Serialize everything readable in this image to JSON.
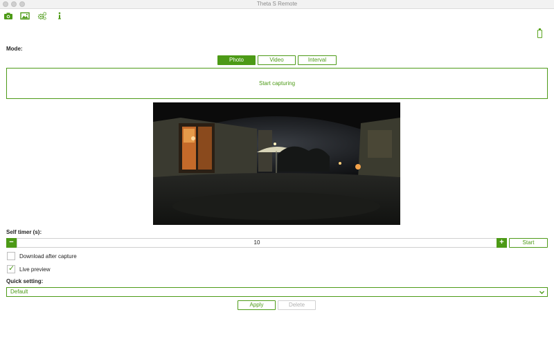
{
  "window": {
    "title": "Theta S Remote"
  },
  "toolbar": {
    "icons": [
      "camera-icon",
      "gallery-icon",
      "settings-gears-icon",
      "info-icon"
    ]
  },
  "status": {
    "battery_icon": "battery-icon"
  },
  "mode": {
    "label": "Mode:",
    "options": [
      "Photo",
      "Video",
      "Interval"
    ],
    "selected": "Photo"
  },
  "capture": {
    "label": "Start capturing"
  },
  "preview": {
    "description_icon": "panorama-preview"
  },
  "self_timer": {
    "label": "Self timer (s):",
    "value": "10",
    "decrement": "−",
    "increment": "+",
    "start_label": "Start"
  },
  "options": {
    "download_after_capture": {
      "label": "Download after capture",
      "checked": false
    },
    "live_preview": {
      "label": "Live preview",
      "checked": true
    }
  },
  "quick_setting": {
    "label": "Quick setting:",
    "value": "Default",
    "apply_label": "Apply",
    "delete_label": "Delete"
  },
  "colors": {
    "accent": "#4c9a16",
    "disabled": "#b0b0b0"
  }
}
